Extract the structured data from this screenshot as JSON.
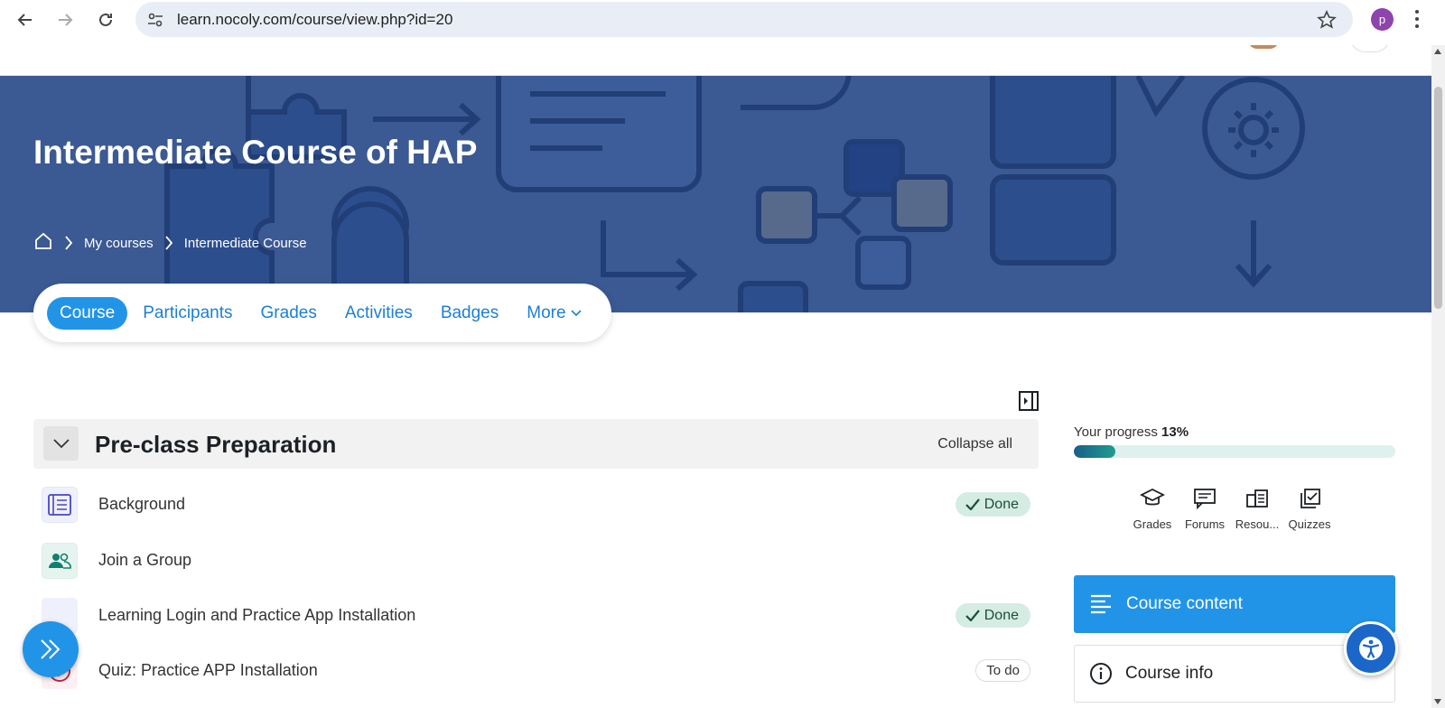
{
  "browser": {
    "url": "learn.nocoly.com/course/view.php?id=20",
    "profile_initial": "p",
    "icons": [
      "back-arrow-icon",
      "forward-arrow-icon",
      "reload-icon",
      "site-settings-icon",
      "bookmark-star-icon",
      "kebab-menu-icon"
    ]
  },
  "header": {
    "course_title": "Intermediate Course of HAP",
    "breadcrumb": [
      {
        "label": "My courses"
      },
      {
        "label": "Intermediate Course"
      }
    ],
    "banner_color": "#3b5993"
  },
  "secondary_nav": {
    "tabs": [
      {
        "label": "Course",
        "active": true
      },
      {
        "label": "Participants"
      },
      {
        "label": "Grades"
      },
      {
        "label": "Activities"
      },
      {
        "label": "Badges"
      },
      {
        "label": "More"
      }
    ]
  },
  "section": {
    "title": "Pre-class Preparation",
    "collapse_label": "Collapse all",
    "activities": [
      {
        "label": "Background",
        "icon": "page-icon",
        "status": "Done"
      },
      {
        "label": "Join a Group",
        "icon": "group-icon",
        "status": ""
      },
      {
        "label": "Learning Login and Practice App Installation",
        "icon": "page-icon",
        "status": "Done"
      },
      {
        "label": "Quiz: Practice APP Installation",
        "icon": "quiz-icon",
        "status": "To do"
      }
    ]
  },
  "sidebar": {
    "progress_label": "Your progress",
    "progress_value": "13%",
    "progress_fraction": 0.13,
    "quicklinks": [
      {
        "label": "Grades",
        "icon": "graduation-cap-icon"
      },
      {
        "label": "Forums",
        "icon": "forum-icon"
      },
      {
        "label": "Resou...",
        "icon": "resources-icon"
      },
      {
        "label": "Quizzes",
        "icon": "quiz-check-icon"
      }
    ],
    "course_content_label": "Course content",
    "course_info_label": "Course info"
  },
  "colors": {
    "accent": "#2294e8",
    "done_badge_bg": "#d5ece2"
  }
}
